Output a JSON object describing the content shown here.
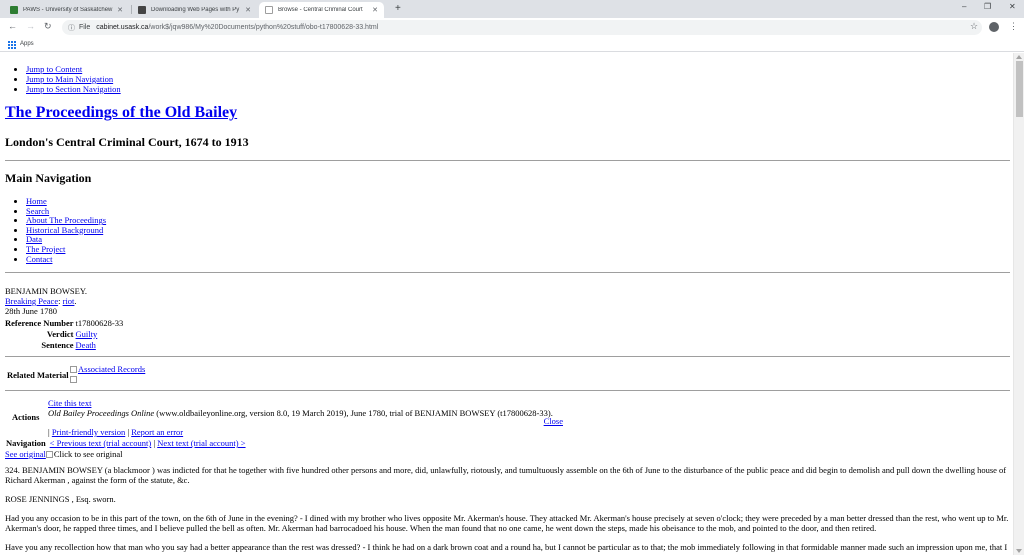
{
  "browser": {
    "tabs": [
      {
        "title": "PAWS - University of Saskatchew",
        "favicon_color": "#2e7d32",
        "active": false
      },
      {
        "title": "Downloading Web Pages with Py",
        "favicon_color": "#444444",
        "active": false
      },
      {
        "title": "Browse - Central Criminal Court",
        "favicon_color": "#9e9e9e",
        "active": true
      }
    ],
    "new_tab_glyph": "+",
    "window_controls": [
      "–",
      "❐",
      "✕"
    ],
    "address": {
      "scheme": "File",
      "host": "cabinet.usask.ca",
      "path": "/work$/jqw986/My%20Documents/python%20stuff/obo-t17800628-33.html"
    },
    "bookmarks": {
      "apps_label": "Apps"
    }
  },
  "page": {
    "skip_links": [
      "Jump to Content",
      "Jump to Main Navigation",
      "Jump to Section Navigation"
    ],
    "site_title": "The Proceedings of the Old Bailey",
    "site_subtitle": "London's Central Criminal Court, 1674 to 1913",
    "main_nav_heading": "Main Navigation",
    "main_nav": [
      "Home",
      "Search",
      "About The Proceedings",
      "Historical Background",
      "Data",
      "The Project",
      "Contact"
    ],
    "defendant": "BENJAMIN BOWSEY.",
    "offence_category": "Breaking Peace",
    "offence_subcategory": "riot",
    "date": "28th June 1780",
    "reference_label": "Reference Number",
    "reference_value": "t17800628-33",
    "verdict_label": "Verdict",
    "verdict_value": "Guilty",
    "sentence_label": "Sentence",
    "sentence_value": "Death",
    "related_label": "Related Material",
    "associated_records": "Associated Records",
    "actions_label": "Actions",
    "cite_link": "Cite this text",
    "citation_italic": "Old Bailey Proceedings Online",
    "citation_rest": " (www.oldbaileyonline.org, version 8.0, 19 March 2019), June 1780, trial of BENJAMIN BOWSEY (t17800628-33).",
    "close": "Close",
    "print_friendly": "Print-friendly version",
    "report_error": "Report an error",
    "navigation_label": "Navigation",
    "prev_text": "< Previous text (trial account)",
    "next_text": "Next text (trial account) >",
    "see_original": "See original",
    "click_to_see": "Click to see original",
    "para1": "324.   BENJAMIN BOWSEY (a blackmoor ) was indicted for that he together with five hundred other persons and more, did, unlawfully, riotously, and tumultuously assemble on the 6th of June to the disturbance of the public peace and did begin to demolish and pull down the dwelling house of  Richard Akerman , against the form of the statute, &c.",
    "para2": " ROSE JENNINGS , Esq. sworn.",
    "para3": "Had you any occasion to be in this part of the town, on the 6th of June in the evening? - I dined with my brother who lives opposite Mr. Akerman's house. They attacked Mr. Akerman's house precisely at seven o'clock; they were preceded by a man better dressed than the rest, who went up to Mr. Akerman's door, he rapped three times, and I believe pulled the bell as often. Mr. Akerman had barrocadoed his house. When the man found that no one came, he went down the steps, made his obeisance to the mob, and pointed to the door, and then retired.",
    "para4": "Have you any recollection how that man who you say had a better appearance than the rest was dressed? - I think he had on a dark brown coat and a round ha, but I cannot be particular as to that; the mob immediately following in that formidable manner made such an impression upon me, that I"
  }
}
